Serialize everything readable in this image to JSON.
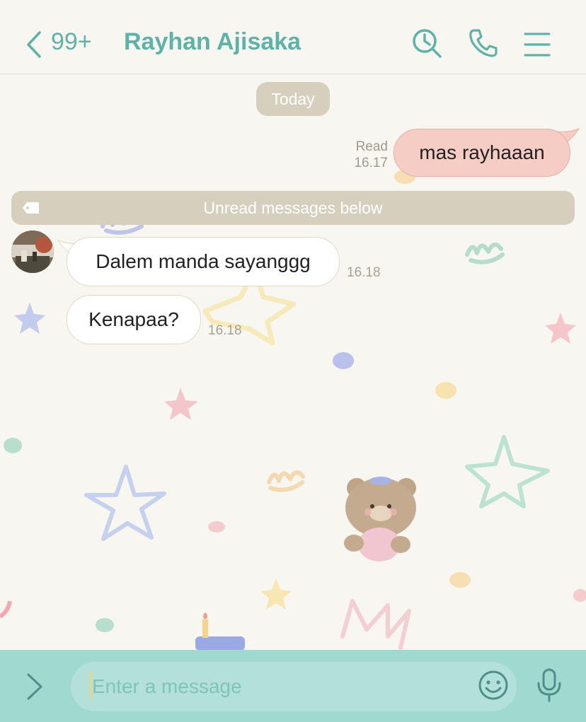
{
  "header": {
    "back_icon": "chevron-left-icon",
    "unread_count": "99+",
    "title": "Rayhan Ajisaka",
    "actions": [
      "search-history-icon",
      "phone-icon",
      "menu-icon"
    ]
  },
  "chat": {
    "date_label": "Today",
    "outgoing": [
      {
        "text": "mas rayhaaan",
        "status": "Read",
        "time": "16.17"
      }
    ],
    "unread_divider": "Unread messages below",
    "incoming": [
      {
        "text": "Dalem manda sayanggg",
        "time": "16.18"
      },
      {
        "text": "Kenapaa?",
        "time": "16.18"
      }
    ]
  },
  "composer": {
    "expand_icon": "chevron-right-icon",
    "placeholder": "Enter a message",
    "emoji_icon": "smiley-icon",
    "mic_icon": "microphone-icon"
  },
  "colors": {
    "accent": "#5eb3a8",
    "outgoing_bubble": "#f6cdc4",
    "pill": "#d6cfbd",
    "composer_bg": "#a0d9d0"
  }
}
